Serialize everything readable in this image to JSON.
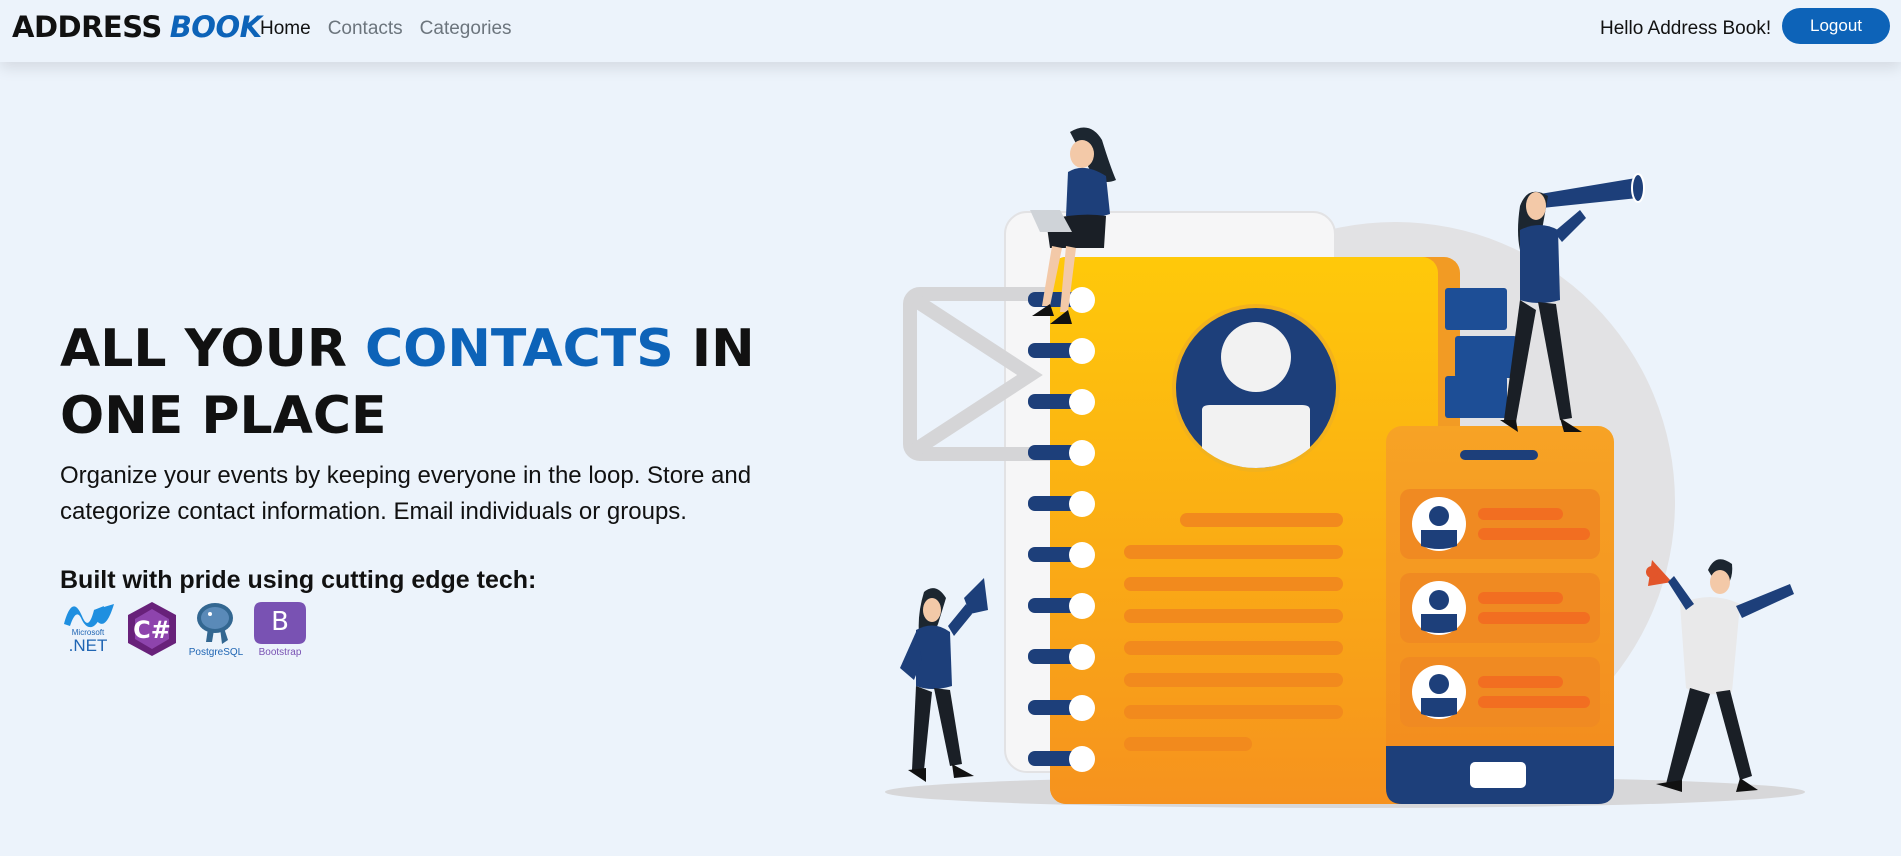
{
  "navbar": {
    "brand_part1": "ADDRESS",
    "brand_part2": "BOOK",
    "links": [
      {
        "label": "Home",
        "active": true
      },
      {
        "label": "Contacts",
        "active": false
      },
      {
        "label": "Categories",
        "active": false
      }
    ],
    "greeting": "Hello Address Book!",
    "logout_label": "Logout"
  },
  "hero": {
    "title_part1": "ALL YOUR ",
    "title_accent": "CONTACTS",
    "title_part2": " IN ONE PLACE",
    "description": "Organize your events by keeping everyone in the loop. Store and categorize contact information. Email individuals or groups.",
    "tech_title": "Built with pride using cutting edge tech:",
    "tech": [
      {
        "icon": "dotnet-icon",
        "caption": ".NET",
        "sub": "Microsoft"
      },
      {
        "icon": "csharp-icon",
        "caption": "C#"
      },
      {
        "icon": "postgresql-icon",
        "caption": "PostgreSQL"
      },
      {
        "icon": "bootstrap-icon",
        "caption": "Bootstrap",
        "letter": "B"
      }
    ]
  },
  "colors": {
    "accent": "#0d63b8",
    "background": "#ecf3fb",
    "notebook": "#f7a823",
    "navy": "#1d3f7a"
  }
}
